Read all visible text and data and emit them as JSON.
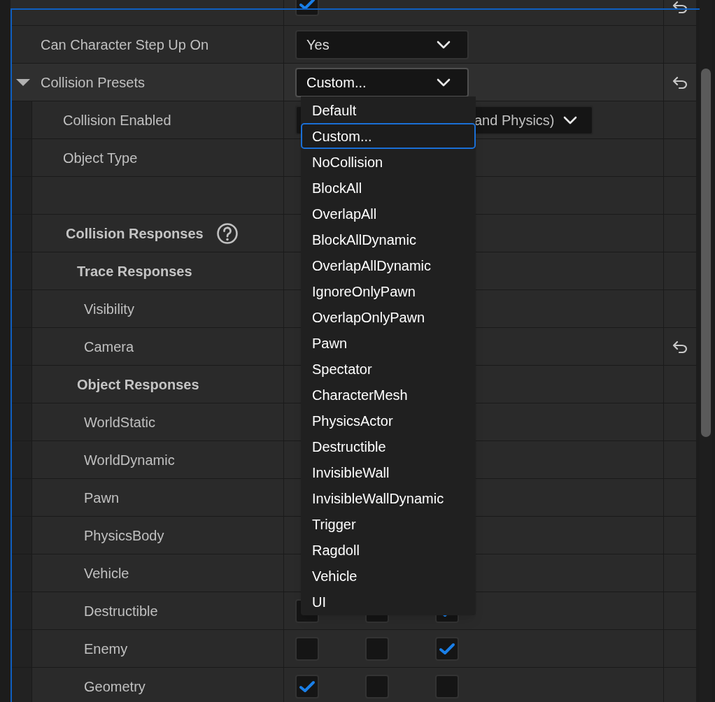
{
  "rows": [
    {
      "kind": "property",
      "value": {
        "kind": "checkbox",
        "checked": true
      },
      "reset": true
    },
    {
      "kind": "property",
      "label": "Can Character Step Up On",
      "value": {
        "kind": "dropdown",
        "text": "Yes"
      },
      "reset": false
    },
    {
      "kind": "property",
      "label": "Collision Presets",
      "expanded": true,
      "value": {
        "kind": "dropdown",
        "text": "Custom..."
      },
      "reset": true,
      "children": [
        {
          "kind": "property",
          "label": "Collision Enabled",
          "value": {
            "kind": "dropdown",
            "text": "and Physics)"
          },
          "reset": false
        },
        {
          "kind": "property",
          "label": "Object Type",
          "reset": false
        },
        {
          "kind": "property",
          "reset": false
        },
        {
          "kind": "category",
          "label": "Collision Responses",
          "help": true,
          "reset": false,
          "children": [
            {
              "kind": "category",
              "label": "Trace Responses",
              "reset": false,
              "children": [
                {
                  "kind": "property",
                  "label": "Visibility",
                  "reset": false
                },
                {
                  "kind": "property",
                  "label": "Camera",
                  "reset": true
                }
              ]
            },
            {
              "kind": "category",
              "label": "Object Responses",
              "reset": false,
              "children": [
                {
                  "kind": "property",
                  "label": "WorldStatic",
                  "reset": false
                },
                {
                  "kind": "property",
                  "label": "WorldDynamic",
                  "reset": false
                },
                {
                  "kind": "property",
                  "label": "Pawn",
                  "reset": false
                },
                {
                  "kind": "property",
                  "label": "PhysicsBody",
                  "reset": false
                },
                {
                  "kind": "property",
                  "label": "Vehicle",
                  "reset": false
                },
                {
                  "kind": "property",
                  "label": "Destructible",
                  "value": {
                    "kind": "checkboxes",
                    "boxes": [
                      {
                        "checked": false
                      },
                      {
                        "checked": false
                      },
                      {
                        "checked": true
                      }
                    ]
                  },
                  "reset": false
                },
                {
                  "kind": "property",
                  "label": "Enemy",
                  "value": {
                    "kind": "checkboxes",
                    "boxes": [
                      {
                        "checked": false
                      },
                      {
                        "checked": false
                      },
                      {
                        "checked": true
                      }
                    ]
                  },
                  "reset": false
                },
                {
                  "kind": "property",
                  "label": "Geometry",
                  "value": {
                    "kind": "checkboxes",
                    "boxes": [
                      {
                        "checked": true
                      },
                      {
                        "checked": false
                      },
                      {
                        "checked": false
                      }
                    ]
                  },
                  "reset": false
                }
              ]
            }
          ]
        }
      ]
    }
  ],
  "dropdown_menu": {
    "items": [
      {
        "label": "Default",
        "selected": false
      },
      {
        "label": "Custom...",
        "selected": true
      },
      {
        "label": "NoCollision",
        "selected": false
      },
      {
        "label": "BlockAll",
        "selected": false
      },
      {
        "label": "OverlapAll",
        "selected": false
      },
      {
        "label": "BlockAllDynamic",
        "selected": false
      },
      {
        "label": "OverlapAllDynamic",
        "selected": false
      },
      {
        "label": "IgnoreOnlyPawn",
        "selected": false
      },
      {
        "label": "OverlapOnlyPawn",
        "selected": false
      },
      {
        "label": "Pawn",
        "selected": false
      },
      {
        "label": "Spectator",
        "selected": false
      },
      {
        "label": "CharacterMesh",
        "selected": false
      },
      {
        "label": "PhysicsActor",
        "selected": false
      },
      {
        "label": "Destructible",
        "selected": false
      },
      {
        "label": "InvisibleWall",
        "selected": false
      },
      {
        "label": "InvisibleWallDynamic",
        "selected": false
      },
      {
        "label": "Trigger",
        "selected": false
      },
      {
        "label": "Ragdoll",
        "selected": false
      },
      {
        "label": "Vehicle",
        "selected": false
      },
      {
        "label": "UI",
        "selected": false
      }
    ]
  }
}
